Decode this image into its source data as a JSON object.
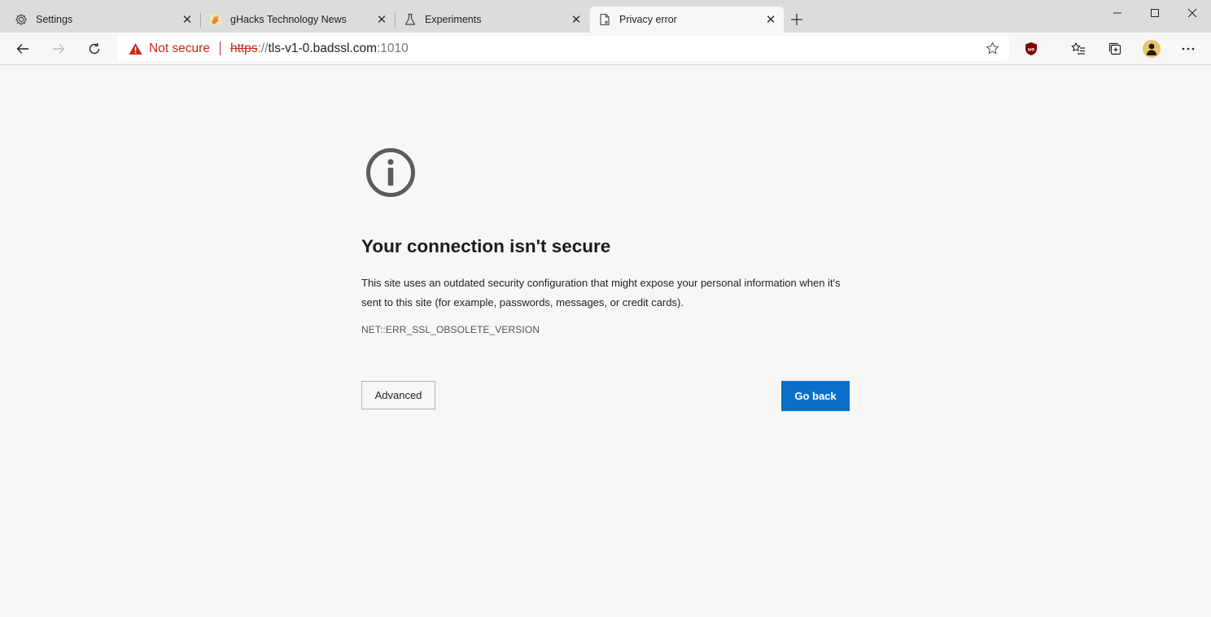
{
  "tabs": [
    {
      "title": "Settings",
      "icon": "gear-icon"
    },
    {
      "title": "gHacks Technology News",
      "icon": "ghacks-favicon-icon"
    },
    {
      "title": "Experiments",
      "icon": "flask-icon"
    },
    {
      "title": "Privacy error",
      "icon": "error-page-icon",
      "active": true
    }
  ],
  "omnibox": {
    "warning_label": "Not secure",
    "scheme": "https",
    "separator": "://",
    "host": "tls-v1-0.badssl.com",
    "port": ":1010"
  },
  "page": {
    "title": "Your connection isn't secure",
    "description": "This site uses an outdated security configuration that might expose your personal information when it's sent to this site (for example, passwords, messages, or credit cards).",
    "error_code": "NET::ERR_SSL_OBSOLETE_VERSION",
    "advanced_label": "Advanced",
    "go_back_label": "Go back"
  },
  "colors": {
    "warning": "#c42b1c",
    "primary_button": "#0a6fc9",
    "page_background": "#f7f7f7",
    "tabstrip_background": "#dcdcdc"
  }
}
